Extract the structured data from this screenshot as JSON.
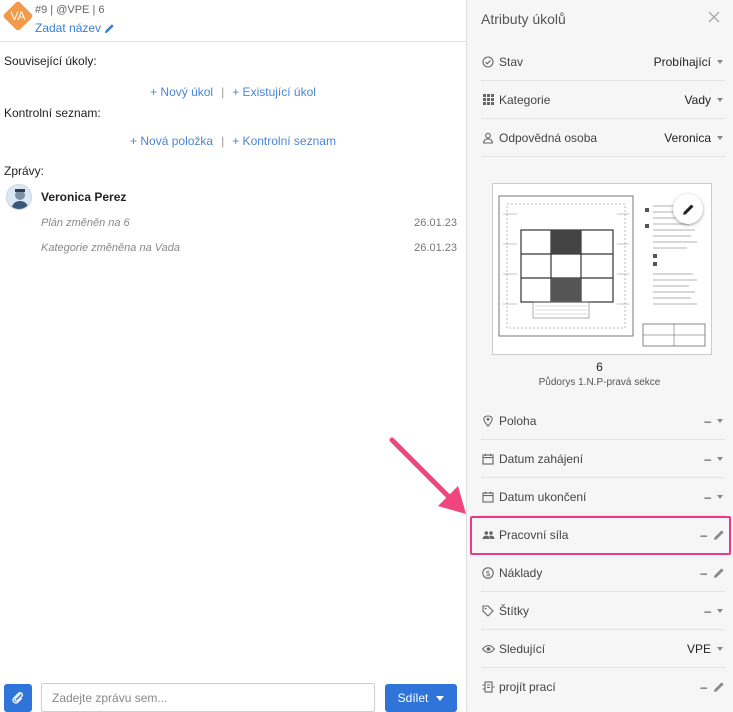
{
  "task": {
    "avatar_initials": "VA",
    "meta": "#9 | @VPE | 6",
    "title_link": "Zadat název"
  },
  "related": {
    "label": "Související úkoly:",
    "new_task": "+ Nový úkol",
    "existing_task": "+ Existující úkol"
  },
  "checklist": {
    "label": "Kontrolní seznam:",
    "new_item": "+ Nová položka",
    "checklist": "+ Kontrolní seznam"
  },
  "messages": {
    "label": "Zprávy:",
    "user": "Veronica Perez",
    "items": [
      {
        "text": "Plán změněn na 6",
        "date": "26.01.23"
      },
      {
        "text": "Kategorie změněna na Vada",
        "date": "26.01.23"
      }
    ]
  },
  "composer": {
    "placeholder": "Zadejte zprávu sem...",
    "share_label": "Sdílet"
  },
  "panel": {
    "title": "Atributy úkolů",
    "attributes_top": [
      {
        "icon": "status-icon",
        "label": "Stav",
        "value": "Probíhající"
      },
      {
        "icon": "grid-icon",
        "label": "Kategorie",
        "value": "Vady"
      },
      {
        "icon": "person-icon",
        "label": "Odpovědná osoba",
        "value": "Veronica"
      }
    ],
    "plan": {
      "number": "6",
      "name": "Půdorys 1.N.P-pravá sekce"
    },
    "attributes_bottom": [
      {
        "icon": "location-pin-icon",
        "label": "Poloha",
        "value": "–",
        "control": "dropdown"
      },
      {
        "icon": "calendar-icon",
        "label": "Datum zahájení",
        "value": "–",
        "control": "dropdown"
      },
      {
        "icon": "calendar-icon",
        "label": "Datum ukončení",
        "value": "–",
        "control": "dropdown"
      },
      {
        "icon": "people-icon",
        "label": "Pracovní síla",
        "value": "–",
        "control": "edit"
      },
      {
        "icon": "dollar-icon",
        "label": "Náklady",
        "value": "–",
        "control": "edit"
      },
      {
        "icon": "tag-icon",
        "label": "Štítky",
        "value": "–",
        "control": "dropdown"
      },
      {
        "icon": "eye-icon",
        "label": "Sledující",
        "value": "VPE",
        "control": "dropdown"
      },
      {
        "icon": "work-progress-icon",
        "label": "projít prací",
        "value": "–",
        "control": "edit"
      }
    ]
  },
  "colors": {
    "accent": "#2f74d8",
    "link": "#4a86d8",
    "avatar_orange": "#f09a4a",
    "highlight": "#e83a87"
  }
}
